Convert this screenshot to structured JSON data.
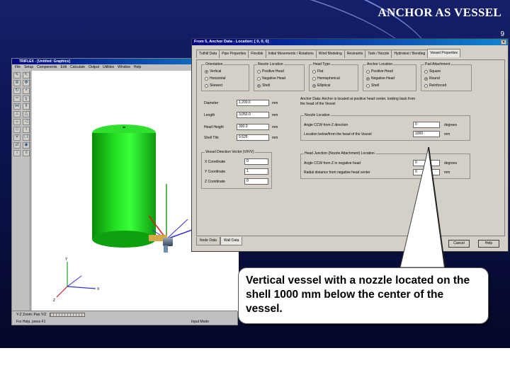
{
  "slide": {
    "title": "ANCHOR AS VESSEL",
    "page_number": "9"
  },
  "app": {
    "title": "TRIFLEX - [Untitled: Graphics]",
    "menu": [
      "File",
      "Setup",
      "Components",
      "Edit",
      "Calculate",
      "Output",
      "Utilities",
      "Window",
      "Help"
    ],
    "status_left": "Y-Z  Zoom:  Pan Y/Z",
    "status_help": "For Help, press F1",
    "status_right": "Input Mode"
  },
  "dialog": {
    "title": "From 5, Anchor Data - Location: [ 0, 0, 0]",
    "close_glyph": "×",
    "tabs": [
      "Tuthill Data",
      "Pipe Properties",
      "Flexible",
      "Initial Movements / Rotations",
      "Wind Modeling",
      "Restraints",
      "Tank / Nozzle",
      "Hydrotest / Bending",
      "Vessel Properties"
    ],
    "active_tab": "Vessel Properties",
    "groups": {
      "orientation": {
        "label": "Orientation",
        "options": [
          "Vertical",
          "Horizontal",
          "Skewed"
        ],
        "selected": "Vertical"
      },
      "nozzle_location": {
        "label": "Nozzle Location",
        "options": [
          "Positive Head",
          "Negative Head",
          "Shell"
        ],
        "selected": "Shell"
      },
      "head_type": {
        "label": "Head Type",
        "options": [
          "Flat",
          "Hemispherical",
          "Elliptical"
        ],
        "selected": "Elliptical"
      },
      "anchor_location": {
        "label": "Anchor Location",
        "options": [
          "Positive Head",
          "Negative Head",
          "Shell"
        ],
        "selected": "Negative Head"
      },
      "pad_attachment": {
        "label": "Pad Attachment",
        "options": [
          "Square",
          "Round",
          "Reinforced"
        ],
        "selected": "Round"
      }
    },
    "fields": {
      "diameter": {
        "label": "Diameter",
        "value": "1,200.0",
        "unit": "mm"
      },
      "length": {
        "label": "Length",
        "value": "3,050.0",
        "unit": "mm"
      },
      "head_height": {
        "label": "Head Height",
        "value": "300.0",
        "unit": "mm"
      },
      "shell_thk": {
        "label": "Shell Thk",
        "value": "9.525",
        "unit": "mm"
      }
    },
    "anchor_note": "Anchor Data: Anchor is located at positive head center, looking back from the head of the Vessel",
    "nozzle_location_group": {
      "label": "Nozzle Location",
      "angle_label": "Angle CCW from Z direction",
      "angle_value": "0",
      "angle_unit": "degrees",
      "location_label": "Location below/from the head of the Vessel",
      "location_value": "1000",
      "location_unit": "mm"
    },
    "vector_group": {
      "label": "Vessel Direction Vector (V/F/V)",
      "x_label": "X Coordinate",
      "x_value": "0",
      "y_label": "Y Coordinate",
      "y_value": "1",
      "z_label": "Z Coordinate",
      "z_value": "0"
    },
    "head_group": {
      "label": "Head Junction (Nozzle Attachment) Location",
      "angle_label": "Angle CCW from Z in negative head",
      "angle_value": "0",
      "angle_unit": "degrees",
      "radial_label": "Radial distance from negative head center",
      "radial_value": "0",
      "radial_unit": "mm"
    },
    "bottom_tabs": [
      "Node Data",
      "Wall Data"
    ],
    "active_bottom_tab": "Wall Data",
    "buttons": {
      "cancel": "Cancel",
      "help": "Help"
    }
  },
  "toolbar_icons": [
    "pencil-icon",
    "select-icon",
    "zoom-icon",
    "pan-icon",
    "rotate-icon",
    "node-icon",
    "pipe-icon",
    "elbow-icon",
    "valve-icon",
    "flange-icon",
    "anchor-icon",
    "restraint-icon",
    "tee-icon",
    "reducer-icon",
    "joint-icon",
    "hanger-icon",
    "delete-icon",
    "copy-icon",
    "move-icon",
    "view-icon",
    "info-icon",
    "list-icon"
  ],
  "callout": {
    "text": "Vertical vessel with a nozzle located on the shell 1000 mm below the center of the vessel."
  },
  "colors": {
    "vessel": "#22dd22",
    "vessel_shade": "#0a8a0a",
    "title_bar": "#000080",
    "axis_x": "#3030d0",
    "axis_y": "#20a020",
    "axis_z": "#d02020"
  }
}
